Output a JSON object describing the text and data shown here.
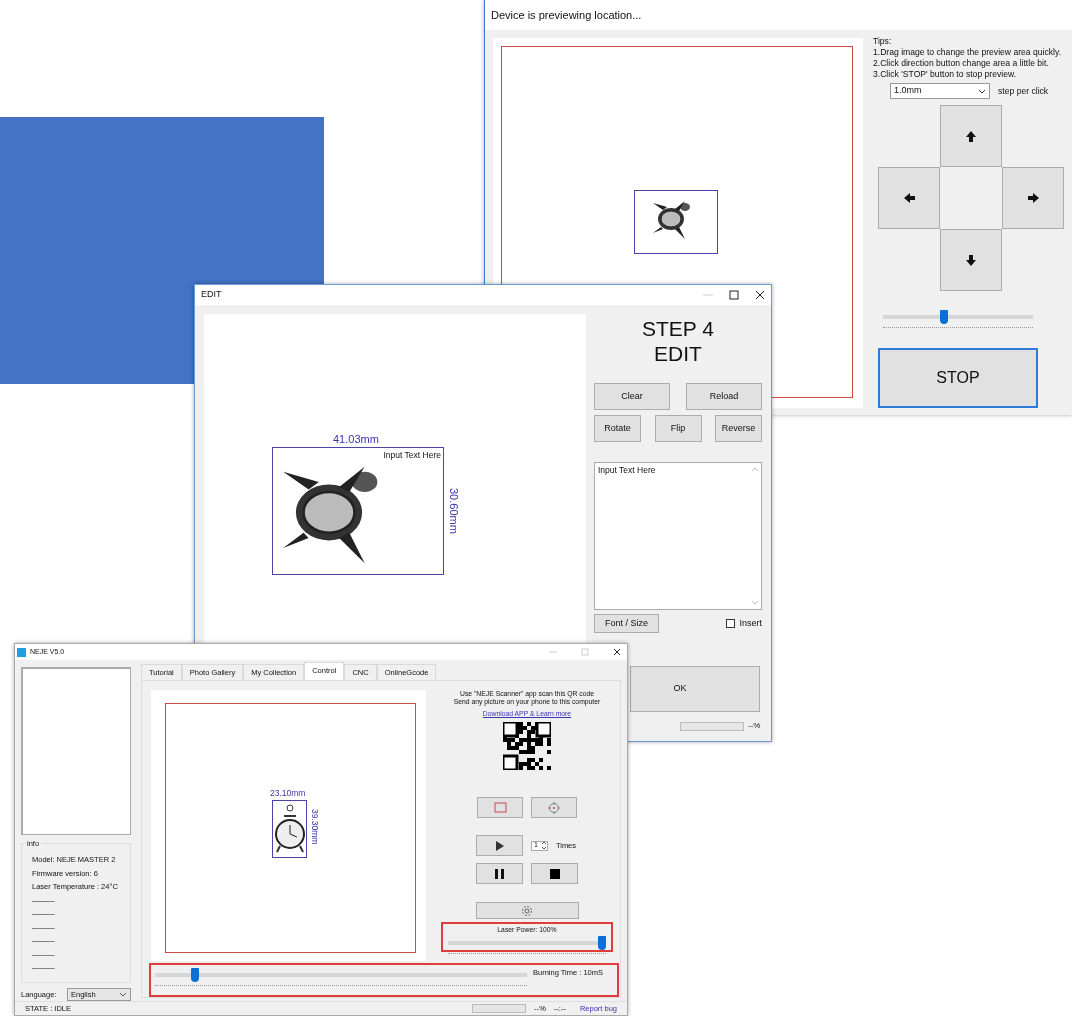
{
  "preview_window": {
    "title": "Device is previewing location...",
    "tips": [
      "Tips:",
      "1.Drag image to change the preview area quickly.",
      "2.Click direction button change area a little bit.",
      "3.Click 'STOP' button to stop preview."
    ],
    "step": {
      "value": "1.0mm",
      "label": "step per click"
    },
    "speed_slider": {
      "level": 0.4
    },
    "stop_button": "STOP"
  },
  "edit_window": {
    "title": "EDIT",
    "width_label": "41.03mm",
    "height_label": "30.60mm",
    "image_text": "Input Text Here",
    "heading": [
      "STEP 4",
      "EDIT"
    ],
    "buttons_row1": [
      "Clear",
      "Reload"
    ],
    "buttons_row2": [
      "Rotate",
      "Flip",
      "Reverse"
    ],
    "text_value": "Input Text Here",
    "font_button": "Font / Size",
    "insert": {
      "label": "Insert",
      "checked": false
    },
    "ok_button": "OK",
    "progress": {
      "level": 0,
      "text": "--%"
    }
  },
  "main_window": {
    "title": "NEJE V5.0",
    "tabs": [
      {
        "label": "Tutorial",
        "selected": false
      },
      {
        "label": "Photo Gallery",
        "selected": false
      },
      {
        "label": "My Collection",
        "selected": false
      },
      {
        "label": "Control",
        "selected": true
      },
      {
        "label": "CNC",
        "selected": false
      },
      {
        "label": "OnlineGcode",
        "selected": false
      }
    ],
    "info": {
      "title": "info",
      "lines": [
        "Model: NEJE MASTER 2",
        "Firmware version: 6",
        "Laser Temperature : 24°C",
        "———",
        "———",
        "———",
        "———",
        "———",
        "———"
      ]
    },
    "language": {
      "label": "Language:",
      "value": "English"
    },
    "state": "STATE : IDLE",
    "width_label": "23.10mm",
    "height_label": "39.30mm",
    "qr_text": [
      "Use \"NEJE Scanner\" app scan this QR code",
      "Send any picture on your phone to this computer"
    ],
    "qr_link": "Download APP & Learn more",
    "times": {
      "value": "1",
      "label": "Times"
    },
    "laser_power": {
      "label": "Laser Power: 100%",
      "level": 1.0
    },
    "burning_time": {
      "label": "Burning Time : 10mS",
      "level": 0.1
    },
    "status": {
      "level": 0,
      "percent": "--%",
      "time": "--:--",
      "link": "Report bug"
    }
  }
}
